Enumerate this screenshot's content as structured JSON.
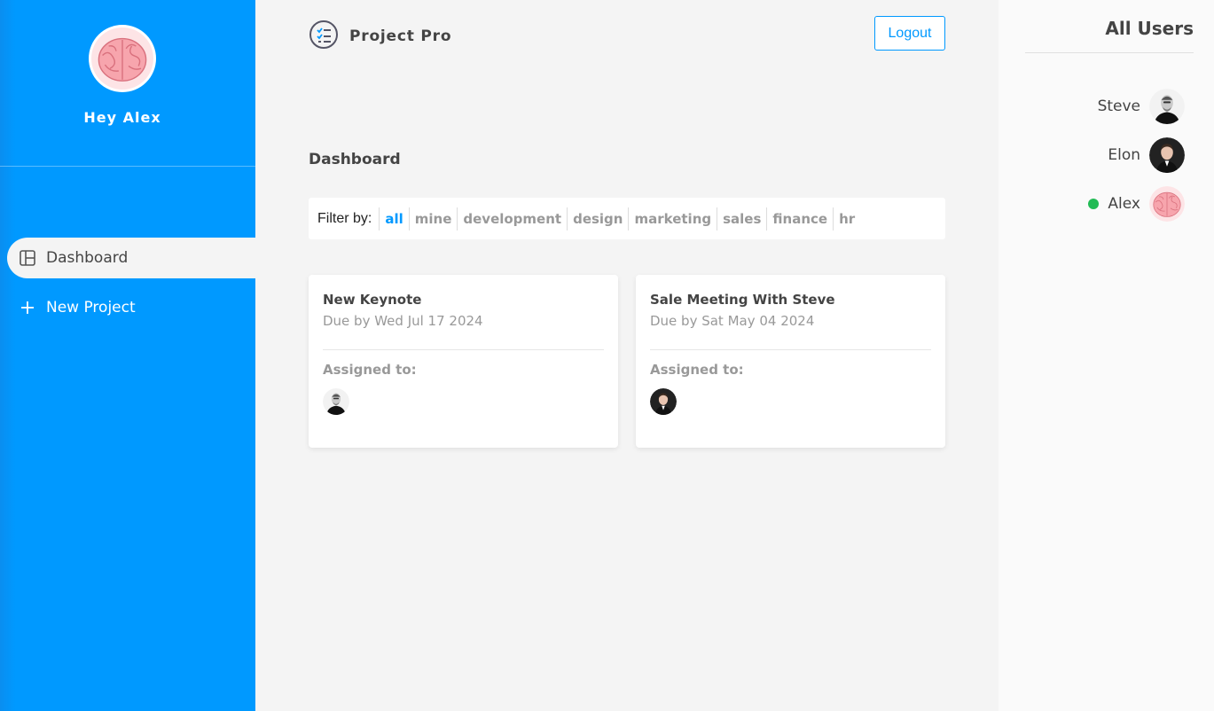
{
  "sidebar": {
    "greeting": "Hey Alex",
    "nav": [
      {
        "label": "Dashboard",
        "icon": "dashboard-icon",
        "active": true
      },
      {
        "label": "New Project",
        "icon": "plus-icon",
        "active": false
      }
    ],
    "color": "#0099ff"
  },
  "header": {
    "brand": "Project Pro",
    "logout_label": "Logout"
  },
  "main": {
    "title": "Dashboard",
    "filter_label": "Filter by:",
    "filters": [
      "all",
      "mine",
      "development",
      "design",
      "marketing",
      "sales",
      "finance",
      "hr"
    ],
    "active_filter": "all",
    "projects": [
      {
        "title": "New Keynote",
        "due": "Due by Wed Jul 17 2024",
        "assigned_label": "Assigned to:",
        "assignee": "Steve"
      },
      {
        "title": "Sale Meeting With Steve",
        "due": "Due by Sat May 04 2024",
        "assigned_label": "Assigned to:",
        "assignee": "Elon"
      }
    ]
  },
  "users_panel": {
    "title": "All Users",
    "users": [
      {
        "name": "Steve",
        "online": false
      },
      {
        "name": "Elon",
        "online": false
      },
      {
        "name": "Alex",
        "online": true
      }
    ],
    "online_color": "#22bb55"
  }
}
